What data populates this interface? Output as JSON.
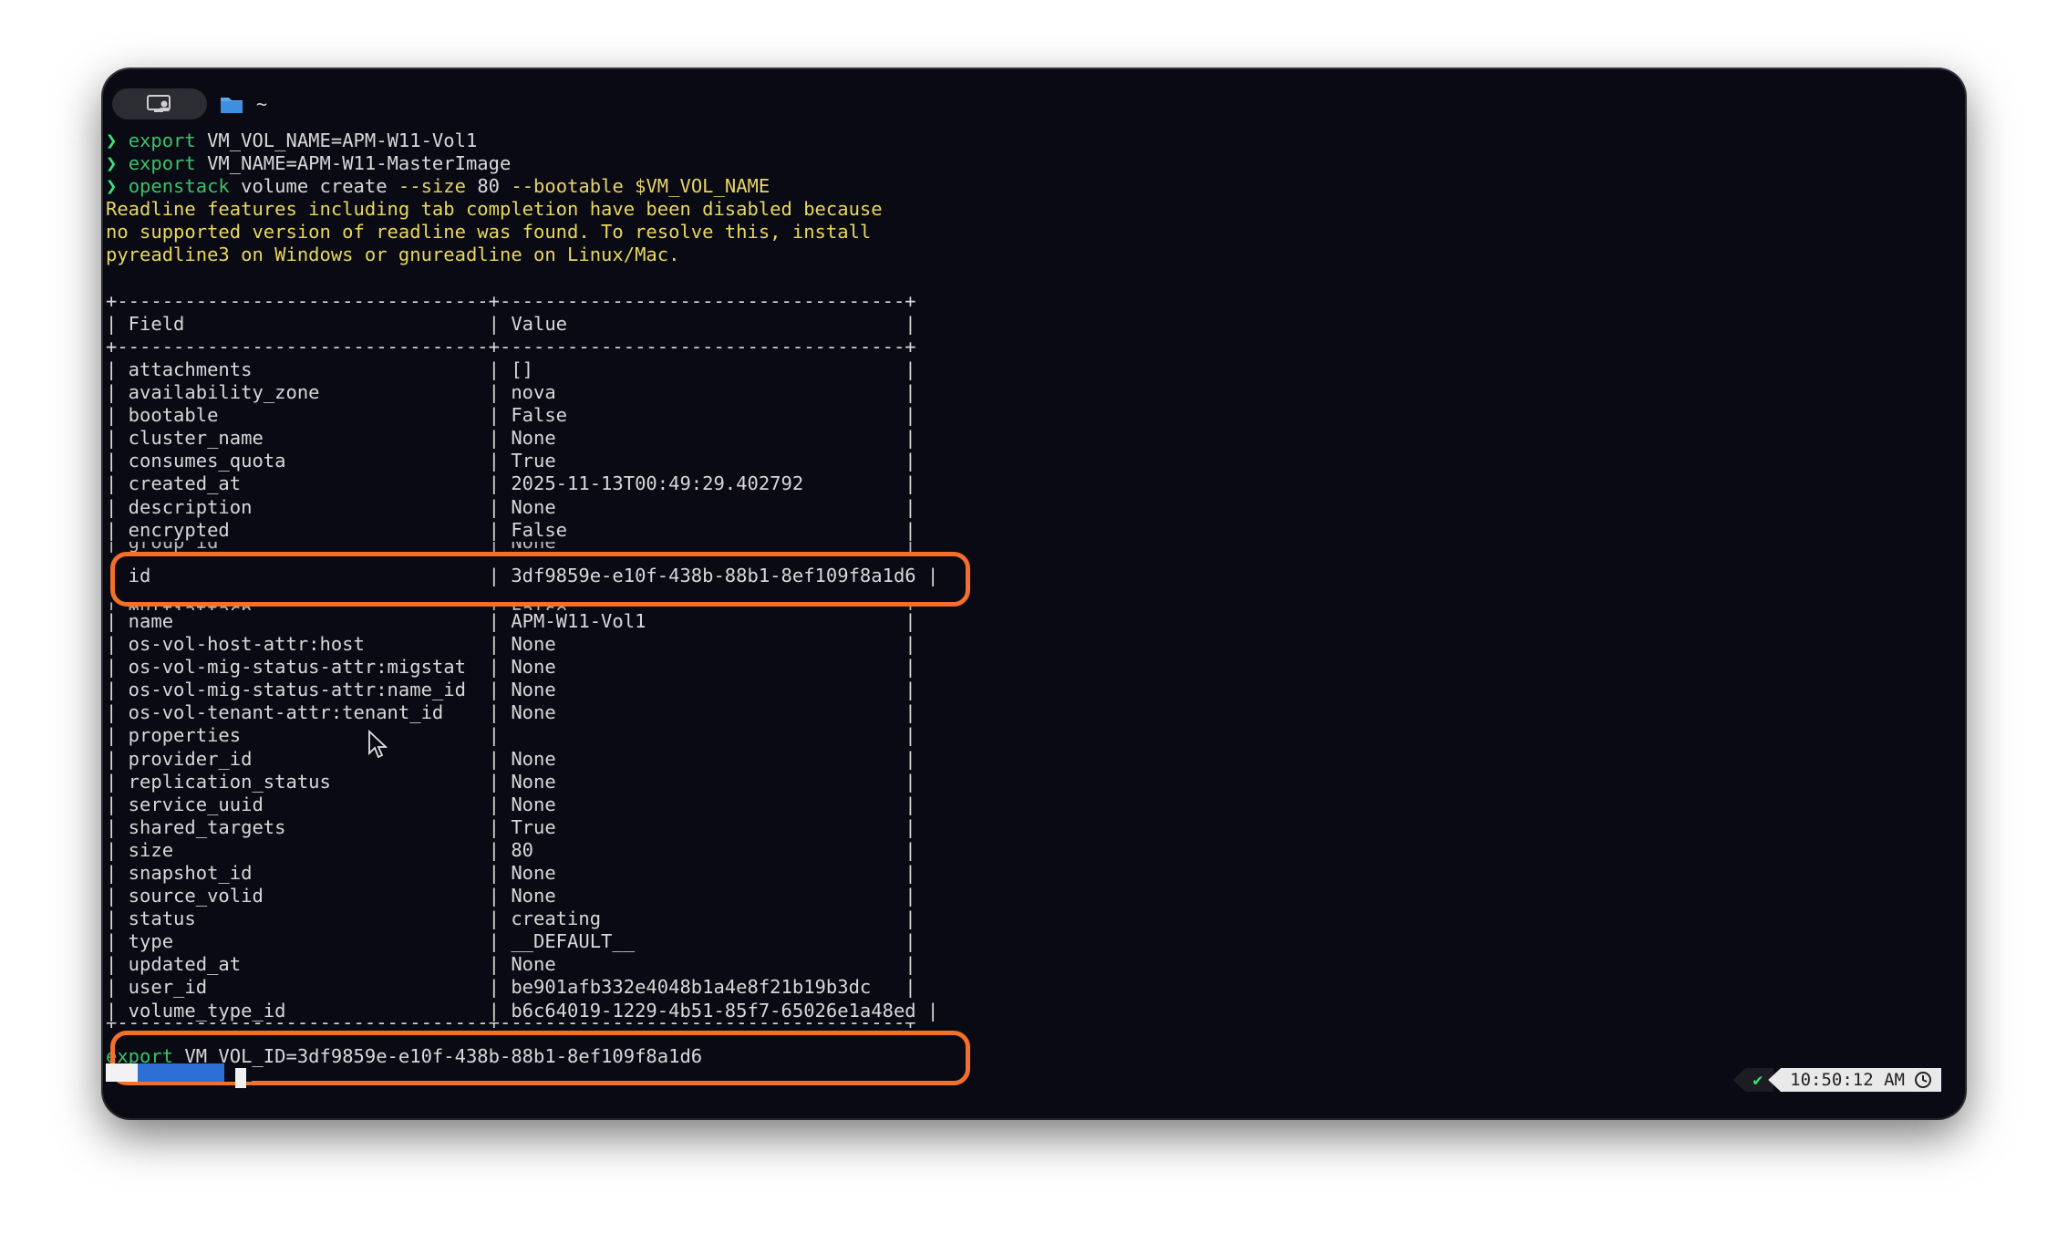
{
  "topbar": {
    "path": "~"
  },
  "commands": [
    {
      "prompt": "❯",
      "cmd": "export",
      "rest": " VM_VOL_NAME=APM-W11-Vol1"
    },
    {
      "prompt": "❯",
      "cmd": "export",
      "rest": " VM_NAME=APM-W11-MasterImage"
    }
  ],
  "command3": {
    "prompt": "❯",
    "cmd": "openstack",
    "part1": " volume create ",
    "flag1": "--size",
    "part2": " 80 ",
    "flag2": "--bootable $VM_VOL_NAME"
  },
  "warning": [
    "Readline features including tab completion have been disabled because",
    "no supported version of readline was found. To resolve this, install",
    "pyreadline3 on Windows or gnureadline on Linux/Mac."
  ],
  "table": {
    "border": "+---------------------------------+------------------------------------+",
    "header": "| Field                           | Value                              |",
    "rows_top": [
      "| attachments                     | []                                 |",
      "| availability_zone               | nova                               |",
      "| bootable                        | False                              |",
      "| cluster_name                    | None                               |",
      "| consumes_quota                  | True                               |",
      "| created_at                      | 2025-11-13T00:49:29.402792         |",
      "| description                     | None                               |",
      "| encrypted                       | False                              |"
    ],
    "row_group": "| group_id                        | None                               |",
    "row_id": "| id                              | 3df9859e-e10f-438b-88b1-8ef109f8a1d6 |",
    "row_multiattach": "| multiattach                     | False                              |",
    "rows_bottom": [
      "| name                            | APM-W11-Vol1                       |",
      "| os-vol-host-attr:host           | None                               |",
      "| os-vol-mig-status-attr:migstat  | None                               |",
      "| os-vol-mig-status-attr:name_id  | None                               |",
      "| os-vol-tenant-attr:tenant_id    | None                               |",
      "| properties                      |                                    |",
      "| provider_id                     | None                               |",
      "| replication_status              | None                               |",
      "| service_uuid                    | None                               |",
      "| shared_targets                  | True                               |",
      "| size                            | 80                                 |",
      "| snapshot_id                     | None                               |",
      "| source_volid                    | None                               |",
      "| status                          | creating                           |",
      "| type                            | __DEFAULT__                        |",
      "| updated_at                      | None                               |",
      "| user_id                         | be901afb332e4048b1a4e8f21b19b3dc   |",
      "| volume_type_id                  | b6c64019-1229-4b51-85f7-65026e1a48ed |"
    ]
  },
  "last_command": {
    "cmd": "export",
    "rest": " VM_VOL_ID=3df9859e-e10f-438b-88b1-8ef109f8a1d6"
  },
  "status": {
    "check": "✔",
    "time": "10:50:12 AM"
  },
  "colors": {
    "highlight": "#f26f2c",
    "background": "#0a0a14",
    "command": "#39c26b",
    "warning": "#e8d85c"
  }
}
